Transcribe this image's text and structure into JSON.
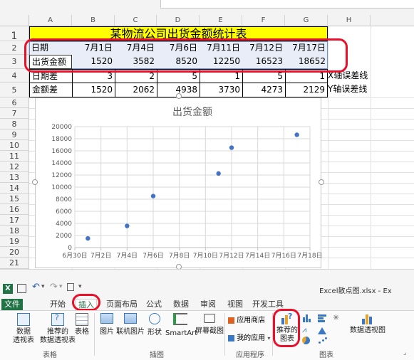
{
  "window_title": "Excel散点图.xlsx - Ex",
  "columns": [
    "A",
    "B",
    "C",
    "D",
    "E",
    "F",
    "G",
    "H"
  ],
  "rows": [
    "1",
    "2",
    "3",
    "4",
    "5",
    "6",
    "7",
    "8",
    "9",
    "10",
    "11",
    "12",
    "13",
    "14",
    "15",
    "16",
    "17",
    "18",
    "19",
    "20",
    "21"
  ],
  "sheet_title": "某物流公司出货金额统计表",
  "table": [
    [
      "日期",
      "7月1日",
      "7月4日",
      "7月6日",
      "7月11日",
      "7月12日",
      "7月17日",
      ""
    ],
    [
      "出货金额",
      "1520",
      "3582",
      "8520",
      "12250",
      "16523",
      "18652",
      ""
    ],
    [
      "日期差",
      "3",
      "2",
      "5",
      "1",
      "5",
      "1",
      "X轴误差线"
    ],
    [
      "金额差",
      "1520",
      "2062",
      "4938",
      "3730",
      "4273",
      "2129",
      "Y轴误差线"
    ]
  ],
  "chart_data": {
    "type": "scatter",
    "title": "出货金额",
    "x_dates": [
      "7月1日",
      "7月4日",
      "7月6日",
      "7月11日",
      "7月12日",
      "7月17日"
    ],
    "x_tick_labels": [
      "6月30日",
      "7月2日",
      "7月4日",
      "7月6日",
      "7月8日",
      "7月10日",
      "7月12日",
      "7月14日",
      "7月16日",
      "7月18日"
    ],
    "y_tick_labels": [
      "0",
      "2000",
      "4000",
      "6000",
      "8000",
      "10000",
      "12000",
      "14000",
      "16000",
      "18000",
      "20000"
    ],
    "values": [
      1520,
      3582,
      8520,
      12250,
      16523,
      18652
    ],
    "ylim": [
      0,
      20000
    ],
    "xlim_days": [
      0,
      18
    ],
    "grid": true,
    "point_color": "#4472c4"
  },
  "ribbon": {
    "file_tab": "文件",
    "tabs": [
      "开始",
      "插入",
      "页面布局",
      "公式",
      "数据",
      "审阅",
      "视图",
      "开发工具"
    ],
    "active_tab": "插入",
    "buttons": {
      "pivot_table": "数据\n透视表",
      "recommended_pivot": "推荐的\n数据透视表",
      "table": "表格",
      "picture": "图片",
      "online_picture": "联机图片",
      "shapes": "形状",
      "smartart": "SmartArt",
      "screenshot": "屏幕截图",
      "app_store": "应用商店",
      "my_apps": "我的应用",
      "recommended_charts": "推荐的\n图表",
      "pivot_chart": "数据透视图"
    },
    "groups": [
      "表格",
      "插图",
      "应用程序",
      "图表"
    ]
  },
  "colors": {
    "title_fill": "#ffff00",
    "accent_green": "#217346",
    "highlight_red": "#e8102a"
  }
}
